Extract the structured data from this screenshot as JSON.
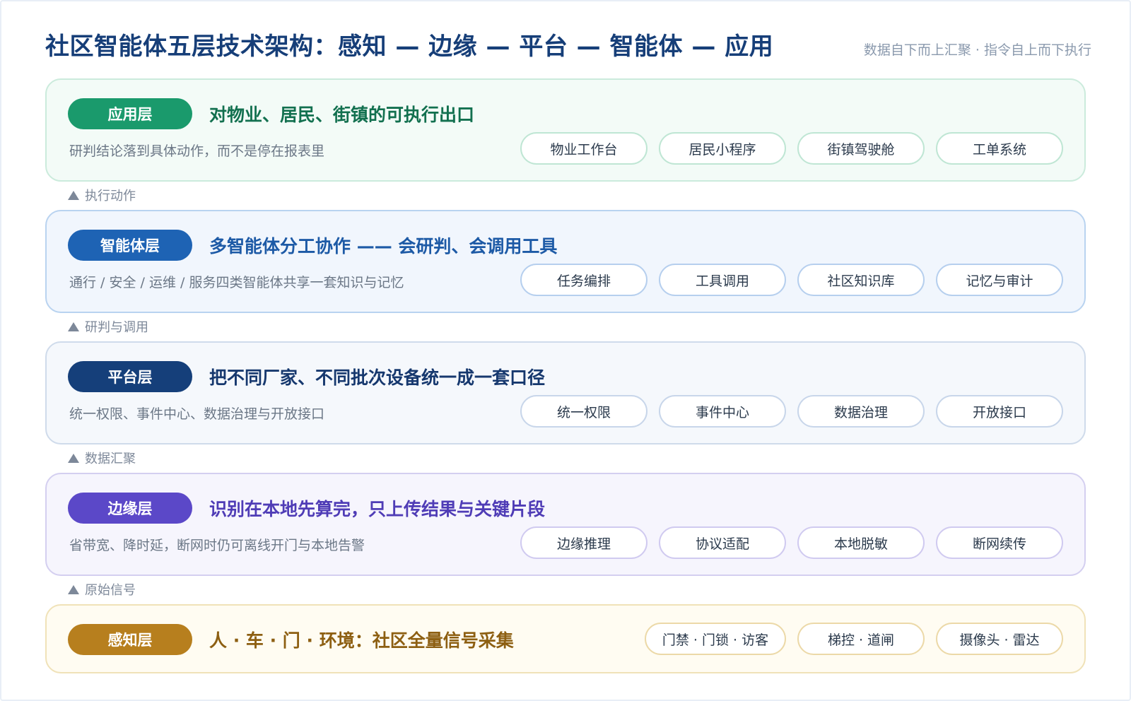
{
  "header": {
    "title": "社区智能体五层技术架构：感知 — 边缘 — 平台 — 智能体 — 应用",
    "subtitle": "数据自下而上汇聚 · 指令自上而下执行"
  },
  "layers": [
    {
      "badge": "应用层",
      "heading": "对物业、居民、街镇的可执行出口",
      "desc": "研判结论落到具体动作，而不是停在报表里",
      "pills": [
        "物业工作台",
        "居民小程序",
        "街镇驾驶舱",
        "工单系统"
      ],
      "color": "#1a9a6c"
    },
    {
      "badge": "智能体层",
      "heading": "多智能体分工协作 —— 会研判、会调用工具",
      "desc": "通行 / 安全 / 运维 / 服务四类智能体共享一套知识与记忆",
      "pills": [
        "任务编排",
        "工具调用",
        "社区知识库",
        "记忆与审计"
      ],
      "color": "#1e63b4"
    },
    {
      "badge": "平台层",
      "heading": "把不同厂家、不同批次设备统一成一套口径",
      "desc": "统一权限、事件中心、数据治理与开放接口",
      "pills": [
        "统一权限",
        "事件中心",
        "数据治理",
        "开放接口"
      ],
      "color": "#153f7a"
    },
    {
      "badge": "边缘层",
      "heading": "识别在本地先算完，只上传结果与关键片段",
      "desc": "省带宽、降时延，断网时仍可离线开门与本地告警",
      "pills": [
        "边缘推理",
        "协议适配",
        "本地脱敏",
        "断网续传"
      ],
      "color": "#5b48c8"
    },
    {
      "badge": "感知层",
      "heading": "人 · 车 · 门 · 环境：社区全量信号采集",
      "pills": [
        "门禁 · 门锁 · 访客",
        "梯控 · 道闸",
        "摄像头 · 雷达"
      ],
      "color": "#b77f1e"
    }
  ],
  "connectors": [
    "执行动作",
    "研判与调用",
    "数据汇聚",
    "原始信号"
  ]
}
